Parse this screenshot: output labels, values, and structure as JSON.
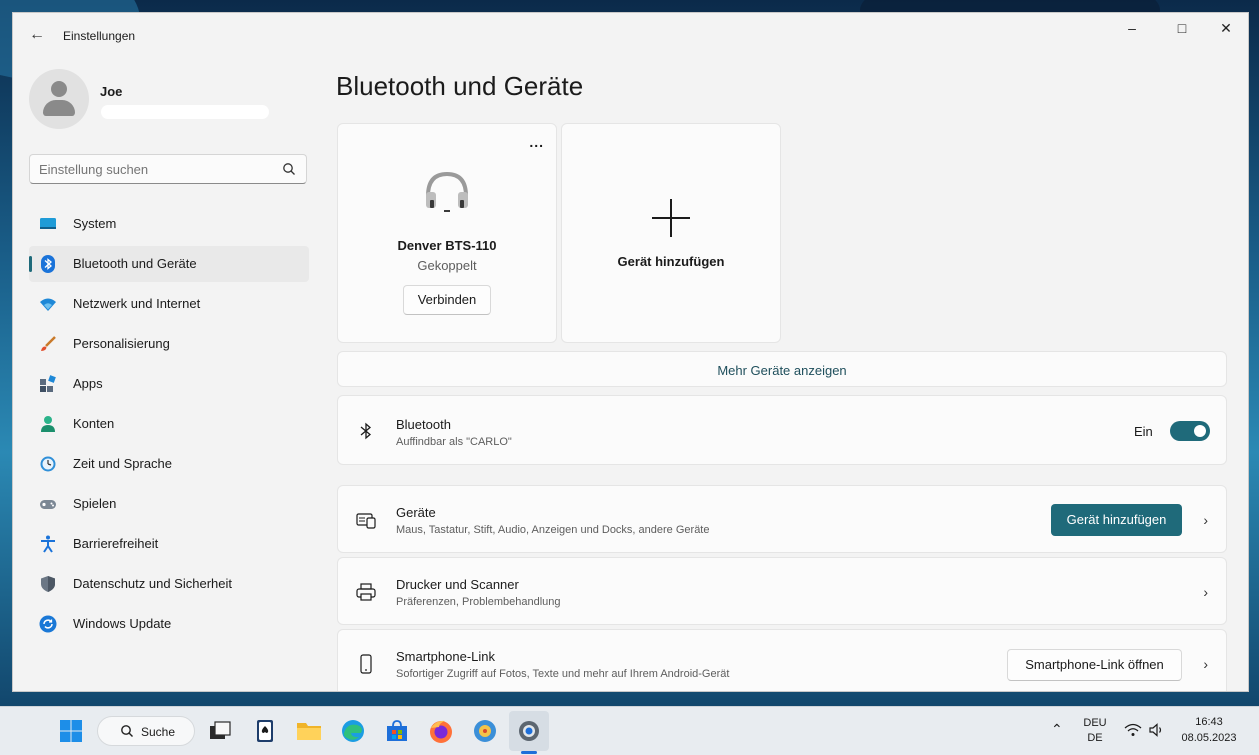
{
  "colors": {
    "accent": "#1f6a7a",
    "window_bg": "#f3f3f3",
    "card_bg": "#fbfbfb"
  },
  "window": {
    "title": "Einstellungen",
    "back_icon": "back-arrow-icon",
    "controls": {
      "minimize": "–",
      "maximize": "□",
      "close": "✕"
    }
  },
  "user": {
    "name": "Joe"
  },
  "search": {
    "placeholder": "Einstellung suchen",
    "icon": "search-icon"
  },
  "sidebar": {
    "items": [
      {
        "label": "System",
        "icon": "system-icon"
      },
      {
        "label": "Bluetooth und Geräte",
        "icon": "bluetooth-icon",
        "active": true
      },
      {
        "label": "Netzwerk und Internet",
        "icon": "wifi-icon"
      },
      {
        "label": "Personalisierung",
        "icon": "brush-icon"
      },
      {
        "label": "Apps",
        "icon": "apps-icon"
      },
      {
        "label": "Konten",
        "icon": "accounts-icon"
      },
      {
        "label": "Zeit und Sprache",
        "icon": "time-language-icon"
      },
      {
        "label": "Spielen",
        "icon": "gamepad-icon"
      },
      {
        "label": "Barrierefreiheit",
        "icon": "accessibility-icon"
      },
      {
        "label": "Datenschutz und Sicherheit",
        "icon": "shield-icon"
      },
      {
        "label": "Windows Update",
        "icon": "windows-update-icon"
      }
    ]
  },
  "main": {
    "title": "Bluetooth und Geräte",
    "device_card": {
      "more": "...",
      "icon": "headset-icon",
      "name": "Denver BTS-110",
      "status": "Gekoppelt",
      "connect_label": "Verbinden"
    },
    "add_card": {
      "icon": "plus-icon",
      "label": "Gerät hinzufügen"
    },
    "more_devices_label": "Mehr Geräte anzeigen",
    "bluetooth_row": {
      "icon": "bluetooth-icon",
      "title": "Bluetooth",
      "subtitle": "Auffindbar als \"CARLO\"",
      "toggle_label": "Ein",
      "toggle_on": true
    },
    "rows": [
      {
        "icon": "keyboard-devices-icon",
        "title": "Geräte",
        "subtitle": "Maus, Tastatur, Stift, Audio, Anzeigen und Docks, andere Geräte",
        "button": "Gerät hinzufügen"
      },
      {
        "icon": "printer-icon",
        "title": "Drucker und Scanner",
        "subtitle": "Präferenzen, Problembehandlung"
      },
      {
        "icon": "smartphone-icon",
        "title": "Smartphone-Link",
        "subtitle": "Sofortiger Zugriff auf Fotos, Texte und mehr auf Ihrem Android-Gerät",
        "button": "Smartphone-Link öffnen"
      }
    ]
  },
  "taskbar": {
    "search_label": "Suche",
    "apps": [
      "windows-start-icon",
      "task-view-icon",
      "solitaire-icon",
      "file-explorer-icon",
      "edge-icon",
      "store-icon",
      "firefox-icon",
      "compass-app-icon",
      "settings-app-icon"
    ],
    "tray": {
      "language_line1": "DEU",
      "language_line2": "DE",
      "time": "16:43",
      "date": "08.05.2023"
    }
  }
}
